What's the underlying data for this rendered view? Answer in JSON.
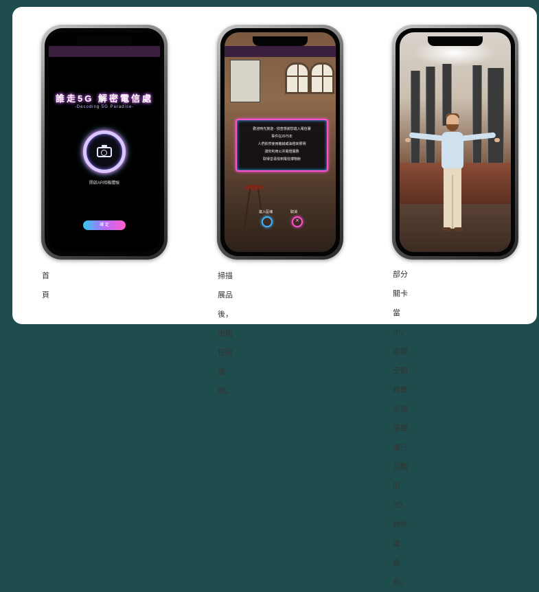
{
  "panels": [
    {
      "caption_lines": [
        "首頁"
      ],
      "screen": {
        "title": "誰走5G 解密電信處",
        "subtitle": "-Decoding 5G Paradise-",
        "hint": "開啟AR相機體驗",
        "button_label": "確 定"
      }
    },
    {
      "caption_lines": [
        "掃描展品後，出現任務說明。"
      ],
      "screen": {
        "dialog_lines": [
          "歡迎時光旅遊 - 偵查感謝您進入電信署",
          "事件在2075年",
          "人們依然使用機械或油燈來照明",
          "請你利用公共電燈服務",
          "取得並尋找到電信博物館"
        ],
        "left_button_label": "進入區塊",
        "right_button_label": "取消"
      }
    },
    {
      "caption_lines": [
        "部分關卡當中，虛擬空間將會",
        "出現需要進行互動的3D物件或",
        "角色。"
      ]
    }
  ],
  "colors": {
    "page_bg": "#1f4d4d",
    "card_bg": "#ffffff",
    "neon_pink": "#ff4fd1",
    "neon_blue": "#3fb4ff"
  }
}
